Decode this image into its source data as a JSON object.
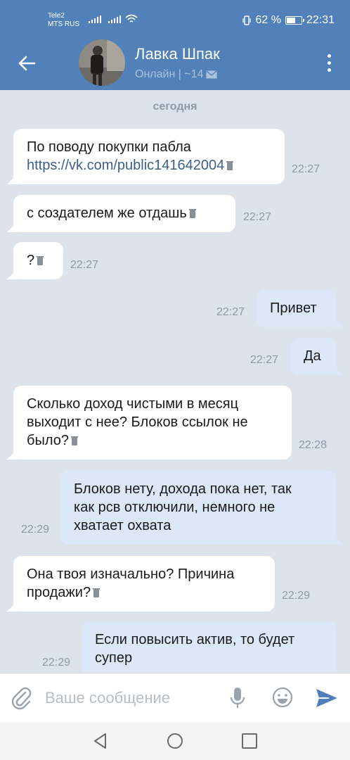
{
  "status_bar": {
    "carrier_1": "Tele2",
    "carrier_2": "MTS RUS",
    "battery": "62 %",
    "battery_level": 0.62,
    "time": "22:31"
  },
  "header": {
    "back_icon": "arrow-left-icon",
    "name": "Лавка Шпак",
    "status": "Онлайн | ~14",
    "mail_icon": "envelope-icon",
    "menu_icon": "more-vertical-icon"
  },
  "date_separator": "сегодня",
  "messages": [
    {
      "direction": "in",
      "lines": [
        "По поводу покупки пабла"
      ],
      "link": "https://vk.com/public141642004",
      "time": "22:27"
    },
    {
      "direction": "in",
      "text": "с создателем же отдашь",
      "time": "22:27"
    },
    {
      "direction": "in",
      "text": "?",
      "time": "22:27"
    },
    {
      "direction": "out",
      "text": "Привет",
      "time": "22:27"
    },
    {
      "direction": "out",
      "text": "Да",
      "time": "22:27"
    },
    {
      "direction": "in",
      "lines": [
        "Сколько доход чистыми в месяц",
        "выходит с нее? Блоков ссылок не",
        "было?"
      ],
      "time": "22:28"
    },
    {
      "direction": "out",
      "lines": [
        "Блоков нету, дохода пока нет, так",
        "как рсв отключили, немного не",
        "хватает охвата"
      ],
      "time": "22:29"
    },
    {
      "direction": "in",
      "lines": [
        "Она твоя изначально? Причина",
        "продажи?"
      ],
      "time": "22:29"
    },
    {
      "direction": "out",
      "lines": [
        "Если повысить актив, то будет",
        "супер"
      ],
      "time": "22:29"
    }
  ],
  "composer": {
    "placeholder": "Ваше сообщение",
    "attach_icon": "paperclip-icon",
    "mic_icon": "microphone-icon",
    "emoji_icon": "smile-icon",
    "send_icon": "send-icon"
  },
  "nav": {
    "back_icon": "triangle-back-icon",
    "home_icon": "circle-home-icon",
    "recents_icon": "square-recents-icon"
  }
}
